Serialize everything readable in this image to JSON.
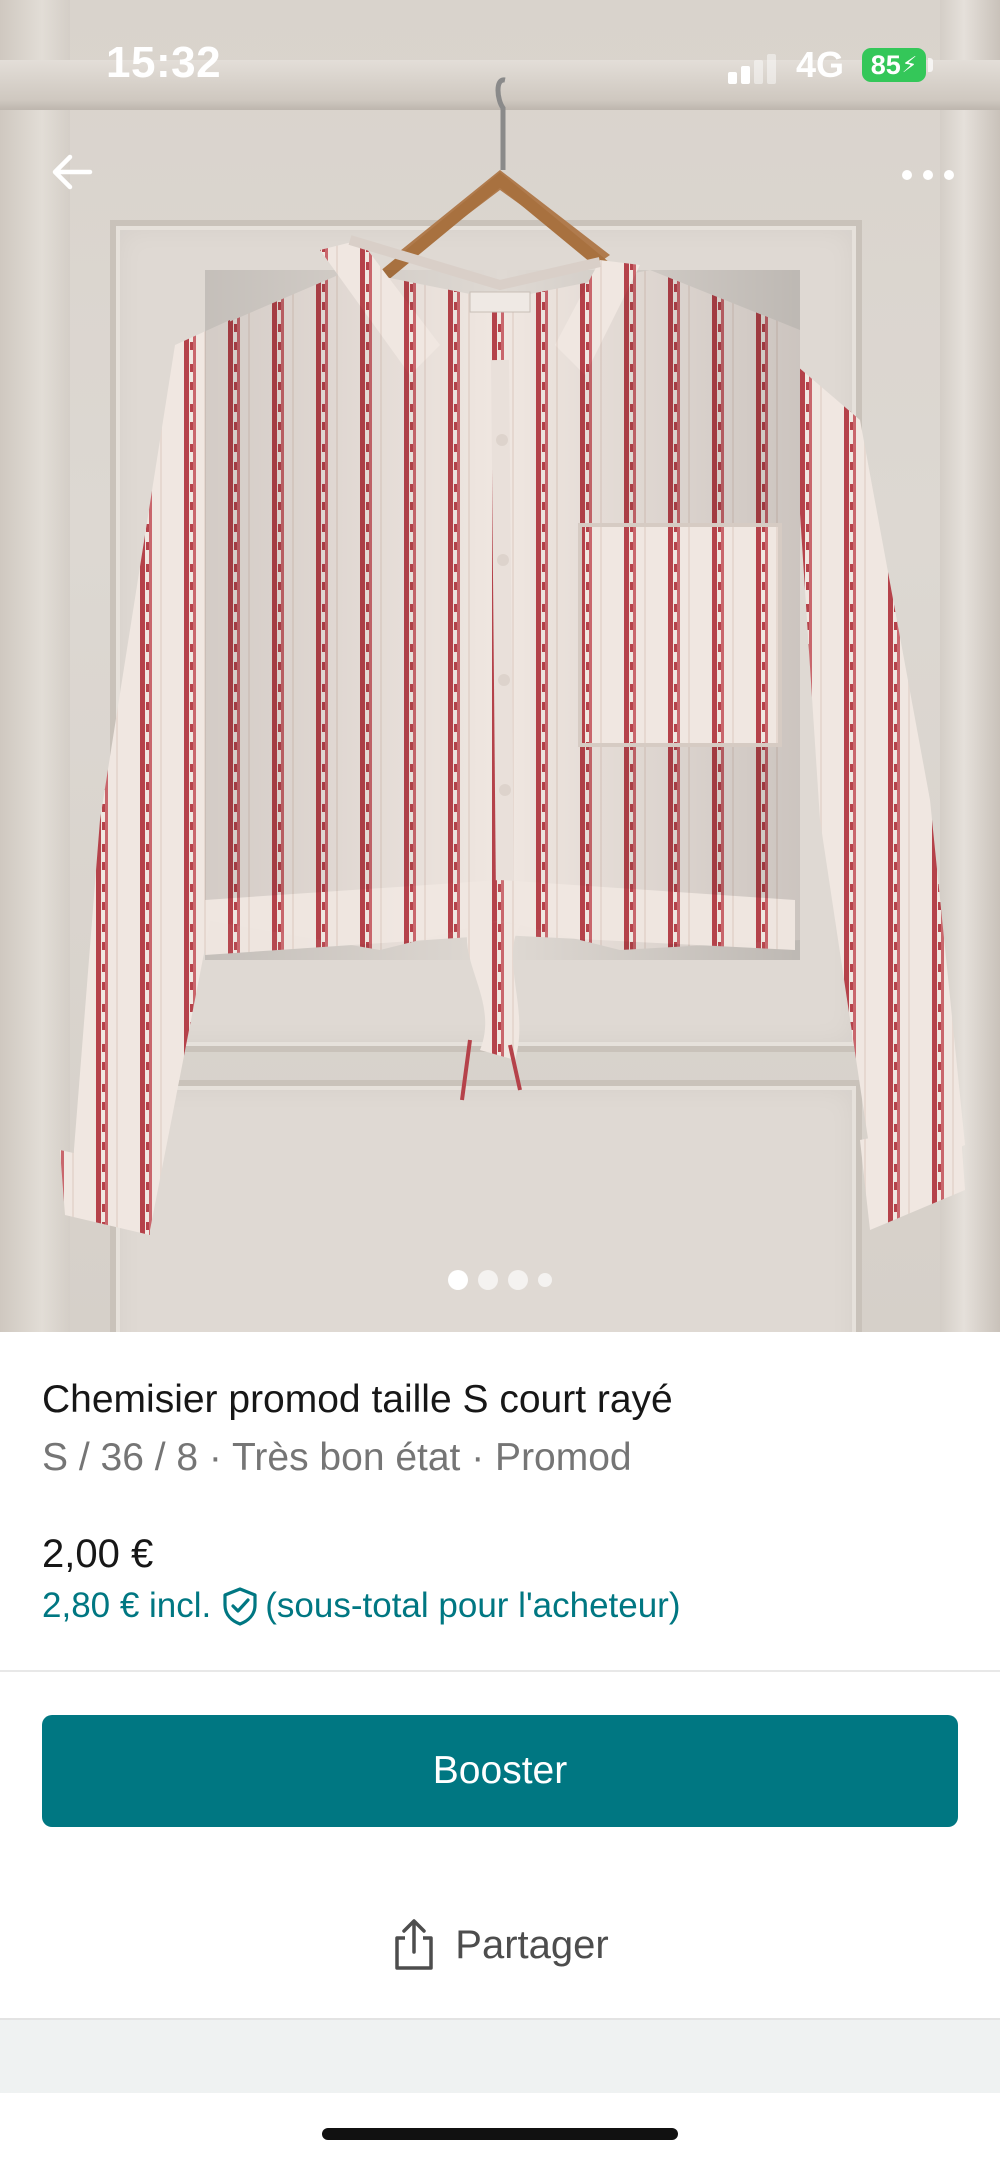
{
  "status_bar": {
    "time": "15:32",
    "network": "4G",
    "battery": "85"
  },
  "photo": {
    "page_indicator": {
      "count": 4,
      "active_index": 0
    }
  },
  "item": {
    "title": "Chemisier promod taille S court rayé",
    "subtitle": "S / 36 / 8 · Très bon état · Promod",
    "price": "2,00 €",
    "price_incl_prefix": "2,80 € incl.",
    "price_incl_suffix": "(sous-total pour l'acheteur)"
  },
  "actions": {
    "boost_label": "Booster",
    "share_label": "Partager"
  },
  "colors": {
    "accent": "#007782",
    "battery": "#34c759",
    "stripe": "#b5424a"
  },
  "icons": [
    "back-arrow-icon",
    "more-dots-icon",
    "shield-check-icon",
    "share-icon",
    "battery-icon",
    "signal-icon"
  ]
}
